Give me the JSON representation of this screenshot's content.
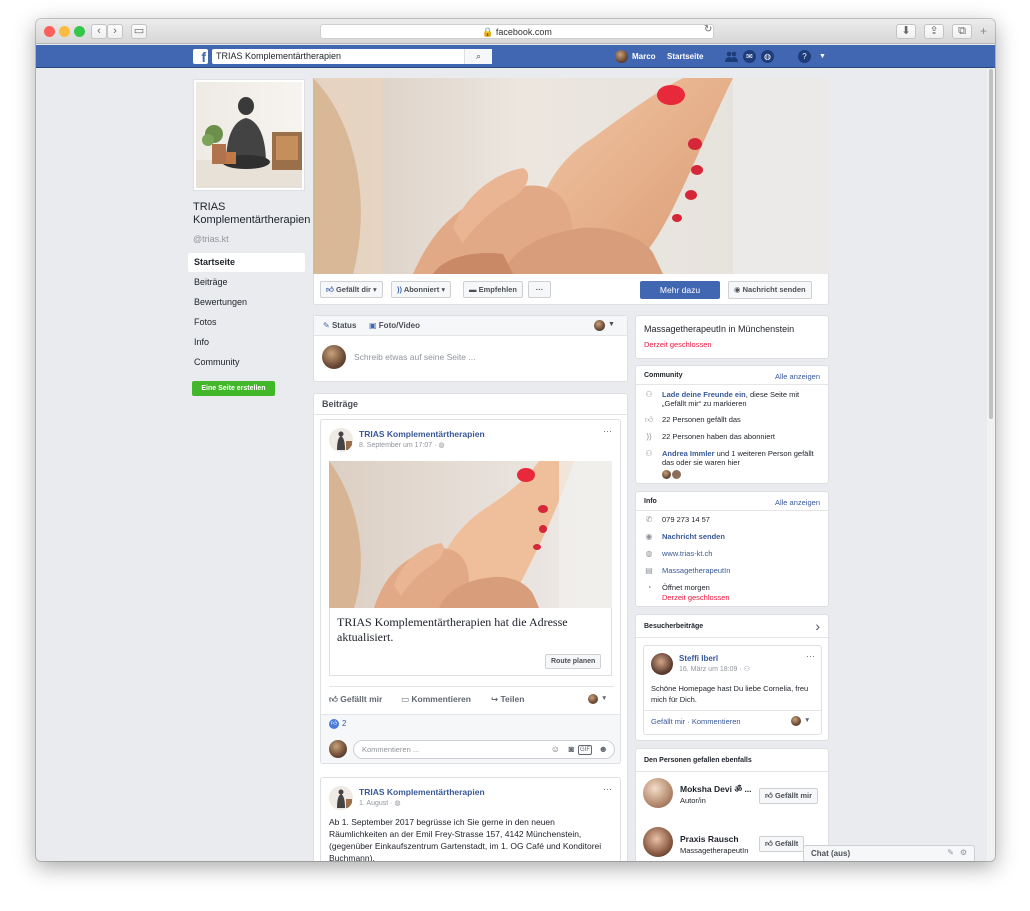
{
  "browser": {
    "url": "facebook.com",
    "colors": {
      "close": "#fc605b",
      "minimize": "#fdbc40",
      "zoom": "#34c84a"
    },
    "icons": [
      "back-icon",
      "forward-icon",
      "sidebar-icon",
      "reload-icon",
      "download-icon",
      "share-icon",
      "tabs-icon",
      "new-tab-icon"
    ]
  },
  "fbbar": {
    "logo": "f",
    "search_value": "TRIAS Komplementärtherapien",
    "search_icon": "⌕",
    "user_name": "Marco",
    "home_label": "Startseite",
    "help_icon": "?",
    "accent": "#4267b2"
  },
  "sidebar": {
    "page_name": "TRIAS Komplementärtherapien",
    "handle": "@trias.kt",
    "nav": [
      {
        "label": "Startseite"
      },
      {
        "label": "Beiträge"
      },
      {
        "label": "Bewertungen"
      },
      {
        "label": "Fotos"
      },
      {
        "label": "Info"
      },
      {
        "label": "Community"
      }
    ],
    "create_page_label": "Eine Seite erstellen",
    "create_page_color": "#42b72a"
  },
  "actions": {
    "like_label": "Gefällt dir",
    "follow_label": "Abonniert",
    "recommend_label": "Empfehlen",
    "more_label": "···",
    "learn_more_label": "Mehr dazu",
    "message_label": "Nachricht senden"
  },
  "composer": {
    "status_label": "Status",
    "photo_label": "Foto/Video",
    "placeholder": "Schreib etwas auf seine Seite ..."
  },
  "posts_header": "Beiträge",
  "post1": {
    "author": "TRIAS Komplementärtherapien",
    "time": "8. September um 17:07 · ",
    "more": "···",
    "caption": "TRIAS Komplementärtherapien hat die Adresse aktualisiert.",
    "route_label": "Route planen",
    "like_label": "Gefällt mir",
    "comment_label": "Kommentieren",
    "share_label": "Teilen",
    "like_count": "2",
    "comment_placeholder": "Kommentieren ..."
  },
  "post2": {
    "author": "TRIAS Komplementärtherapien",
    "time": "1. August · ",
    "more": "···",
    "text": "Ab 1. September 2017 begrüsse ich Sie gerne in den neuen Räumlichkeiten an der Emil Frey-Strasse 157, 4142 Münchenstein, (gegenüber Einkaufszentrum Gartenstadt, im 1. OG Café und Konditorei Buchmann)."
  },
  "about": {
    "category_location": "MassagetherapeutIn in Münchenstein",
    "status": "Derzeit geschlossen"
  },
  "community": {
    "title": "Community",
    "see_all": "Alle anzeigen",
    "invite_link": "Lade deine Freunde ein",
    "invite_rest": ", diese Seite mit „Gefällt mir“ zu markieren",
    "likes": "22 Personen gefällt das",
    "follows": "22 Personen haben das abonniert",
    "friend_link": "Andrea Immler",
    "friend_rest": " und 1 weiteren Person gefällt das oder sie waren hier"
  },
  "info": {
    "title": "Info",
    "see_all": "Alle anzeigen",
    "phone": "079 273 14 57",
    "message": "Nachricht senden",
    "website": "www.trias-kt.ch",
    "category": "MassagetherapeutIn",
    "hours": "Öffnet morgen",
    "status": "Derzeit geschlossen"
  },
  "visitor": {
    "title": "Besucherbeiträge",
    "chevron": "›",
    "author": "Steffi Iberl",
    "time": "16. März um 18:09 · ",
    "more": "···",
    "text": "Schöne Homepage hast Du liebe Cornelia, freu mich für Dich.",
    "actions": "Gefällt mir · Kommentieren"
  },
  "also_liked": {
    "title": "Den Personen gefallen ebenfalls",
    "items": [
      {
        "name": "Moksha Devi ॐ ...",
        "category": "Autor/in",
        "button": "Gefällt mir"
      },
      {
        "name": "Praxis Rausch",
        "category": "MassagetherapeutIn",
        "button": "Gefällt"
      }
    ]
  },
  "chat": {
    "label": "Chat (aus)"
  }
}
